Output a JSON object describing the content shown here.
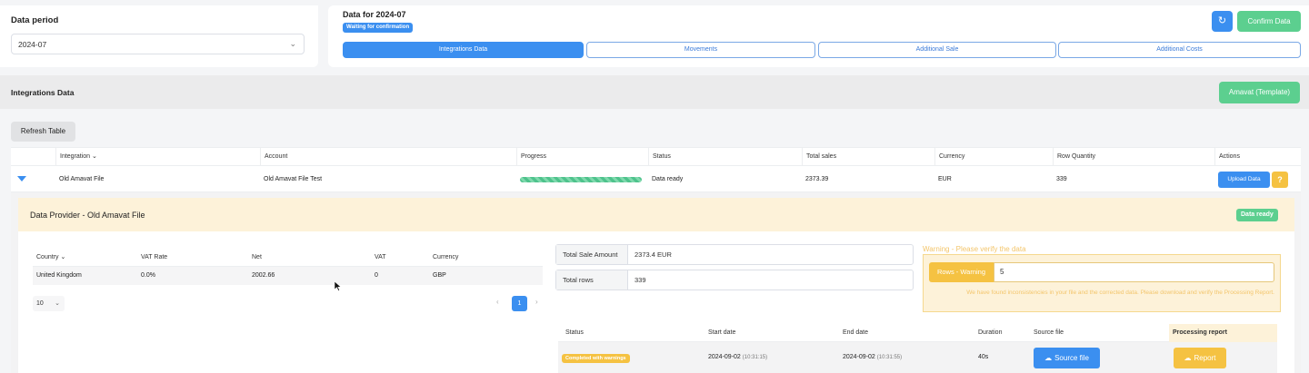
{
  "period": {
    "title": "Data period",
    "value": "2024-07",
    "chevron": "chevron-down-icon"
  },
  "header": {
    "title": "Data for 2024-07",
    "status_badge": "Waiting for confirmation",
    "refresh_icon": "refresh-icon",
    "confirm_label": "Confirm Data"
  },
  "tabs": [
    {
      "label": "Integrations Data",
      "active": true
    },
    {
      "label": "Movements",
      "active": false
    },
    {
      "label": "Additional Sale",
      "active": false
    },
    {
      "label": "Additional Costs",
      "active": false
    }
  ],
  "section": {
    "title": "Integrations Data",
    "template_button": "Amavat (Template)"
  },
  "refresh_table_label": "Refresh Table",
  "table": {
    "columns": [
      "Integration",
      "Account",
      "Progress",
      "Status",
      "Total sales",
      "Currency",
      "Row Quantity",
      "Actions"
    ],
    "row": {
      "integration": "Old Amavat File",
      "account": "Old Amavat File Test",
      "progress": 1.0,
      "status": "Data ready",
      "total_sales": "2373.39",
      "currency": "EUR",
      "row_quantity": "339",
      "upload_label": "Upload Data",
      "help_label": "?"
    }
  },
  "provider": {
    "title": "Data Provider - Old Amavat File",
    "badge": "Data ready",
    "sub_columns": [
      "Country",
      "VAT Rate",
      "Net",
      "VAT",
      "Currency"
    ],
    "sub_row": {
      "country": "United Kingdom",
      "vat_rate": "0.0%",
      "net": "2002.66",
      "vat": "0",
      "currency": "GBP"
    },
    "page_size": "10",
    "current_page": "1",
    "summary": {
      "sale_label": "Total Sale Amount",
      "sale_value": "2373.4 EUR",
      "rows_label": "Total rows",
      "rows_value": "339"
    },
    "warning": {
      "title": "Warning - Please verify the data",
      "label": "Rows - Warning",
      "value": "5",
      "text": "We have found inconsistencies in your file and the corrected data. Please download and verify the Processing Report."
    },
    "processing": {
      "columns": [
        "Status",
        "Start date",
        "End date",
        "Duration",
        "Source file",
        "Processing report"
      ],
      "status": "Completed with warnings",
      "start_date": "2024-09-02",
      "start_time": "(10:31:15)",
      "end_date": "2024-09-02",
      "end_time": "(10:31:55)",
      "duration": "40s",
      "source_label": "Source file",
      "report_label": "Report"
    }
  }
}
